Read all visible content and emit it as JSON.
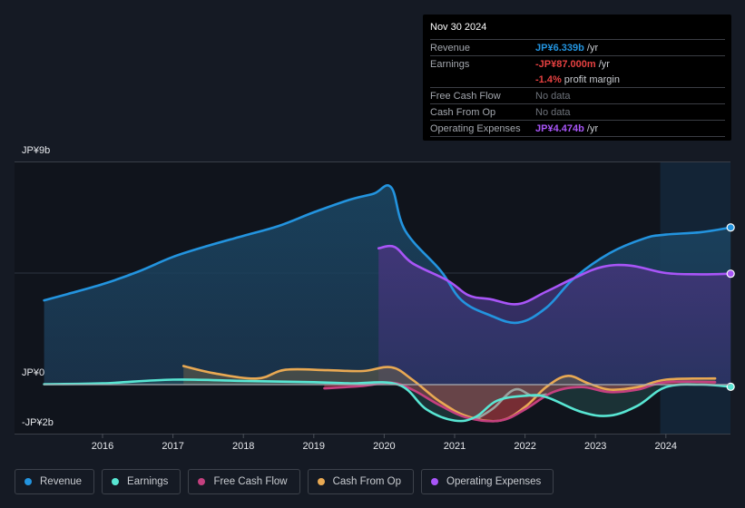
{
  "tooltip": {
    "date": "Nov 30 2024",
    "rows": [
      {
        "key": "Revenue",
        "value": "JP¥6.339b",
        "unit": " /yr",
        "color": "#2394df"
      },
      {
        "key": "Earnings",
        "value": "-JP¥87.000m",
        "unit": " /yr",
        "color": "#e64141"
      },
      {
        "key": "",
        "value": "-1.4%",
        "unit": " profit margin",
        "color": "#e64141"
      },
      {
        "key": "Free Cash Flow",
        "value": "No data",
        "unit": "",
        "color": ""
      },
      {
        "key": "Cash From Op",
        "value": "No data",
        "unit": "",
        "color": ""
      },
      {
        "key": "Operating Expenses",
        "value": "JP¥4.474b",
        "unit": " /yr",
        "color": "#a855f7"
      }
    ]
  },
  "legend": [
    {
      "label": "Revenue",
      "color": "#2394df"
    },
    {
      "label": "Earnings",
      "color": "#58e6d3"
    },
    {
      "label": "Free Cash Flow",
      "color": "#c4407f"
    },
    {
      "label": "Cash From Op",
      "color": "#e9a953"
    },
    {
      "label": "Operating Expenses",
      "color": "#a855f7"
    }
  ],
  "chart_data": {
    "type": "area",
    "title": "",
    "xlabel": "",
    "ylabel": "",
    "currency": "JP¥",
    "y_unit": "billions",
    "ylim": [
      -2,
      9
    ],
    "xlim": [
      2015.0,
      2024.92
    ],
    "y_tick_labels": [
      {
        "value": 9,
        "label": "JP¥9b"
      },
      {
        "value": 0,
        "label": "JP¥0"
      },
      {
        "value": -2,
        "label": "-JP¥2b"
      }
    ],
    "x_ticks": [
      2016,
      2017,
      2018,
      2019,
      2020,
      2021,
      2022,
      2023,
      2024
    ],
    "x_tick_labels": [
      "2016",
      "2017",
      "2018",
      "2019",
      "2020",
      "2021",
      "2022",
      "2023",
      "2024"
    ],
    "highlight_start": 2023.92,
    "grid": "horizontal",
    "legend_position": "bottom",
    "series": [
      {
        "name": "Revenue",
        "color": "#2394df",
        "points": [
          [
            2015.17,
            3.4
          ],
          [
            2015.5,
            3.65
          ],
          [
            2016.0,
            4.05
          ],
          [
            2016.5,
            4.55
          ],
          [
            2017.0,
            5.15
          ],
          [
            2017.5,
            5.6
          ],
          [
            2018.0,
            6.0
          ],
          [
            2018.5,
            6.4
          ],
          [
            2019.0,
            6.95
          ],
          [
            2019.5,
            7.45
          ],
          [
            2019.85,
            7.7
          ],
          [
            2020.1,
            7.95
          ],
          [
            2020.3,
            6.2
          ],
          [
            2020.8,
            4.6
          ],
          [
            2021.1,
            3.4
          ],
          [
            2021.5,
            2.8
          ],
          [
            2021.9,
            2.5
          ],
          [
            2022.3,
            3.1
          ],
          [
            2022.7,
            4.3
          ],
          [
            2023.2,
            5.3
          ],
          [
            2023.7,
            5.9
          ],
          [
            2024.0,
            6.05
          ],
          [
            2024.5,
            6.15
          ],
          [
            2024.92,
            6.339
          ]
        ]
      },
      {
        "name": "Operating Expenses",
        "color": "#a855f7",
        "points": [
          [
            2019.92,
            5.5
          ],
          [
            2020.15,
            5.55
          ],
          [
            2020.4,
            4.9
          ],
          [
            2020.9,
            4.2
          ],
          [
            2021.2,
            3.6
          ],
          [
            2021.5,
            3.45
          ],
          [
            2021.9,
            3.25
          ],
          [
            2022.3,
            3.75
          ],
          [
            2022.7,
            4.3
          ],
          [
            2023.1,
            4.75
          ],
          [
            2023.5,
            4.8
          ],
          [
            2024.0,
            4.5
          ],
          [
            2024.5,
            4.45
          ],
          [
            2024.92,
            4.474
          ]
        ]
      },
      {
        "name": "Earnings",
        "color": "#58e6d3",
        "points": [
          [
            2015.17,
            0.02
          ],
          [
            2016.0,
            0.05
          ],
          [
            2017.0,
            0.2
          ],
          [
            2018.0,
            0.15
          ],
          [
            2019.0,
            0.1
          ],
          [
            2019.5,
            0.05
          ],
          [
            2020.2,
            0.0
          ],
          [
            2020.6,
            -1.0
          ],
          [
            2021.0,
            -1.45
          ],
          [
            2021.3,
            -1.3
          ],
          [
            2021.6,
            -0.65
          ],
          [
            2022.0,
            -0.45
          ],
          [
            2022.3,
            -0.5
          ],
          [
            2022.8,
            -1.1
          ],
          [
            2023.2,
            -1.25
          ],
          [
            2023.6,
            -0.85
          ],
          [
            2024.0,
            -0.1
          ],
          [
            2024.5,
            0.0
          ],
          [
            2024.92,
            -0.087
          ]
        ]
      },
      {
        "name": "Free Cash Flow",
        "color": "#c4407f",
        "points": [
          [
            2019.15,
            -0.15
          ],
          [
            2019.7,
            -0.05
          ],
          [
            2020.1,
            0.08
          ],
          [
            2020.4,
            -0.2
          ],
          [
            2020.8,
            -0.85
          ],
          [
            2021.2,
            -1.35
          ],
          [
            2021.65,
            -1.45
          ],
          [
            2022.0,
            -1.0
          ],
          [
            2022.4,
            -0.3
          ],
          [
            2022.8,
            -0.1
          ],
          [
            2023.2,
            -0.3
          ],
          [
            2023.6,
            -0.2
          ],
          [
            2024.0,
            0.1
          ],
          [
            2024.7,
            0.1
          ]
        ]
      },
      {
        "name": "Cash From Op",
        "color": "#e9a953",
        "points": [
          [
            2017.15,
            0.75
          ],
          [
            2017.6,
            0.45
          ],
          [
            2018.2,
            0.25
          ],
          [
            2018.6,
            0.6
          ],
          [
            2019.2,
            0.58
          ],
          [
            2019.7,
            0.55
          ],
          [
            2020.1,
            0.7
          ],
          [
            2020.4,
            0.2
          ],
          [
            2020.8,
            -0.7
          ],
          [
            2021.2,
            -1.3
          ],
          [
            2021.65,
            -1.45
          ],
          [
            2022.0,
            -0.9
          ],
          [
            2022.3,
            -0.1
          ],
          [
            2022.6,
            0.35
          ],
          [
            2022.9,
            0.05
          ],
          [
            2023.2,
            -0.2
          ],
          [
            2023.6,
            -0.1
          ],
          [
            2024.0,
            0.2
          ],
          [
            2024.7,
            0.25
          ]
        ]
      },
      {
        "name": "Free Cash Flow (grey overlap)",
        "color": "#9aa3a0",
        "points": [
          [
            2021.3,
            -1.4
          ],
          [
            2021.55,
            -0.95
          ],
          [
            2021.85,
            -0.2
          ],
          [
            2022.1,
            -0.45
          ],
          [
            2022.3,
            -0.4
          ]
        ]
      }
    ]
  }
}
